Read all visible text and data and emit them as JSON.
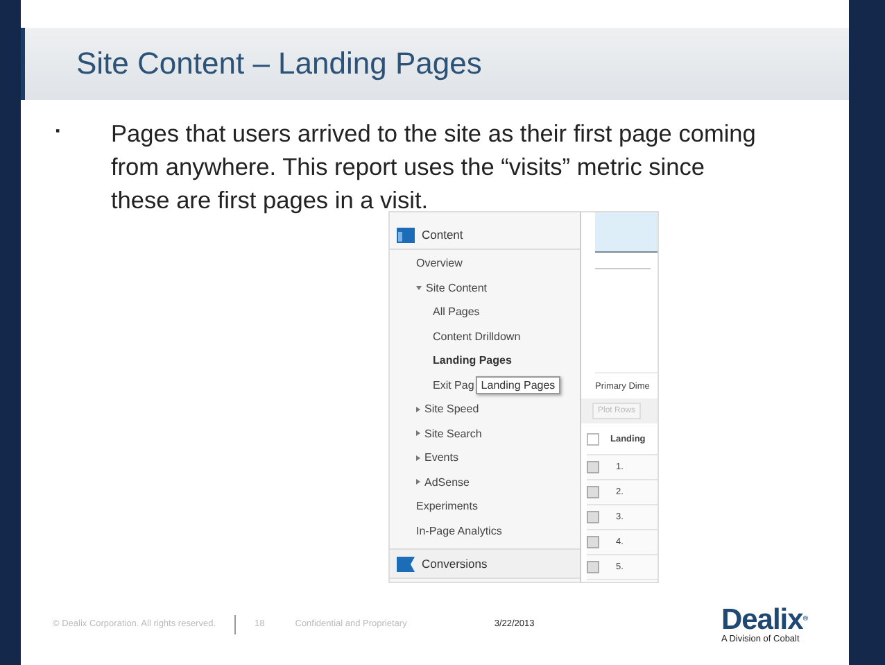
{
  "slide": {
    "title": "Site Content – Landing Pages",
    "bullet": {
      "marker": "▪",
      "text": "Pages that users arrived to the site as their first page coming from anywhere. This report uses the “visits” metric since these are first pages in a visit."
    }
  },
  "screenshot": {
    "nav": [
      {
        "kind": "section",
        "label": "Content",
        "children": [
          {
            "kind": "item",
            "label": "Overview"
          },
          {
            "kind": "group",
            "label": "Site Content",
            "expanded": true,
            "children": [
              {
                "kind": "item",
                "label": "All Pages",
                "selected": false
              },
              {
                "kind": "item",
                "label": "Content Drilldown",
                "selected": false
              },
              {
                "kind": "item",
                "label": "Landing Pages",
                "selected": true
              },
              {
                "kind": "item",
                "label": "Exit Pag",
                "selected": false,
                "tooltip": "Landing Pages"
              }
            ]
          },
          {
            "kind": "group",
            "label": "Site Speed",
            "expanded": false
          },
          {
            "kind": "group",
            "label": "Site Search",
            "expanded": false
          },
          {
            "kind": "group",
            "label": "Events",
            "expanded": false
          },
          {
            "kind": "group",
            "label": "AdSense",
            "expanded": false
          },
          {
            "kind": "item",
            "label": "Experiments"
          },
          {
            "kind": "item",
            "label": "In-Page Analytics"
          }
        ]
      },
      {
        "kind": "section",
        "label": "Conversions"
      }
    ],
    "report": {
      "dimension_label": "Primary Dime",
      "plot_button": "Plot Rows",
      "column_header": "Landing",
      "header_checked": false,
      "rows": [
        {
          "number": "1.",
          "checked": false
        },
        {
          "number": "2.",
          "checked": false
        },
        {
          "number": "3.",
          "checked": false
        },
        {
          "number": "4.",
          "checked": false
        },
        {
          "number": "5.",
          "checked": false
        }
      ]
    }
  },
  "footer": {
    "copyright": "© Dealix Corporation. All rights reserved.",
    "page": "18",
    "confidential": "Confidential and Proprietary",
    "date": "3/22/2013",
    "logo": "Dealix$^{®}$",
    "tagline": "A Division of Cobalt"
  }
}
